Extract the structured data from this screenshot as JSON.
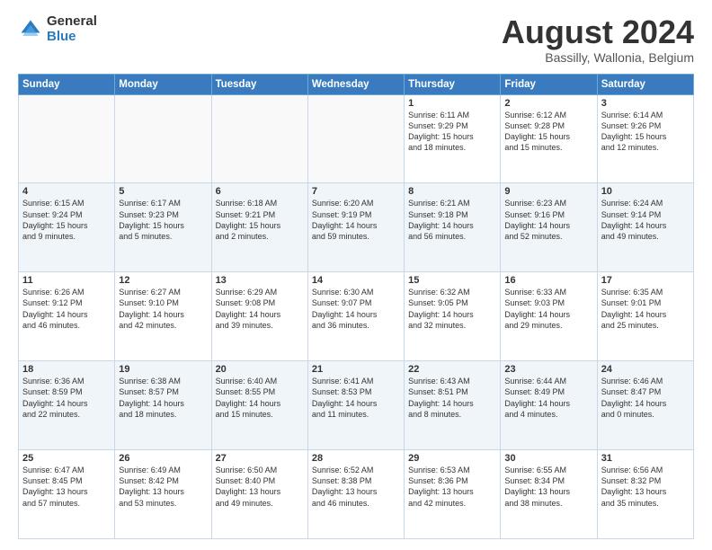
{
  "header": {
    "logo_general": "General",
    "logo_blue": "Blue",
    "month_title": "August 2024",
    "subtitle": "Bassilly, Wallonia, Belgium"
  },
  "calendar": {
    "days_of_week": [
      "Sunday",
      "Monday",
      "Tuesday",
      "Wednesday",
      "Thursday",
      "Friday",
      "Saturday"
    ],
    "weeks": [
      [
        {
          "day": "",
          "info": ""
        },
        {
          "day": "",
          "info": ""
        },
        {
          "day": "",
          "info": ""
        },
        {
          "day": "",
          "info": ""
        },
        {
          "day": "1",
          "info": "Sunrise: 6:11 AM\nSunset: 9:29 PM\nDaylight: 15 hours\nand 18 minutes."
        },
        {
          "day": "2",
          "info": "Sunrise: 6:12 AM\nSunset: 9:28 PM\nDaylight: 15 hours\nand 15 minutes."
        },
        {
          "day": "3",
          "info": "Sunrise: 6:14 AM\nSunset: 9:26 PM\nDaylight: 15 hours\nand 12 minutes."
        }
      ],
      [
        {
          "day": "4",
          "info": "Sunrise: 6:15 AM\nSunset: 9:24 PM\nDaylight: 15 hours\nand 9 minutes."
        },
        {
          "day": "5",
          "info": "Sunrise: 6:17 AM\nSunset: 9:23 PM\nDaylight: 15 hours\nand 5 minutes."
        },
        {
          "day": "6",
          "info": "Sunrise: 6:18 AM\nSunset: 9:21 PM\nDaylight: 15 hours\nand 2 minutes."
        },
        {
          "day": "7",
          "info": "Sunrise: 6:20 AM\nSunset: 9:19 PM\nDaylight: 14 hours\nand 59 minutes."
        },
        {
          "day": "8",
          "info": "Sunrise: 6:21 AM\nSunset: 9:18 PM\nDaylight: 14 hours\nand 56 minutes."
        },
        {
          "day": "9",
          "info": "Sunrise: 6:23 AM\nSunset: 9:16 PM\nDaylight: 14 hours\nand 52 minutes."
        },
        {
          "day": "10",
          "info": "Sunrise: 6:24 AM\nSunset: 9:14 PM\nDaylight: 14 hours\nand 49 minutes."
        }
      ],
      [
        {
          "day": "11",
          "info": "Sunrise: 6:26 AM\nSunset: 9:12 PM\nDaylight: 14 hours\nand 46 minutes."
        },
        {
          "day": "12",
          "info": "Sunrise: 6:27 AM\nSunset: 9:10 PM\nDaylight: 14 hours\nand 42 minutes."
        },
        {
          "day": "13",
          "info": "Sunrise: 6:29 AM\nSunset: 9:08 PM\nDaylight: 14 hours\nand 39 minutes."
        },
        {
          "day": "14",
          "info": "Sunrise: 6:30 AM\nSunset: 9:07 PM\nDaylight: 14 hours\nand 36 minutes."
        },
        {
          "day": "15",
          "info": "Sunrise: 6:32 AM\nSunset: 9:05 PM\nDaylight: 14 hours\nand 32 minutes."
        },
        {
          "day": "16",
          "info": "Sunrise: 6:33 AM\nSunset: 9:03 PM\nDaylight: 14 hours\nand 29 minutes."
        },
        {
          "day": "17",
          "info": "Sunrise: 6:35 AM\nSunset: 9:01 PM\nDaylight: 14 hours\nand 25 minutes."
        }
      ],
      [
        {
          "day": "18",
          "info": "Sunrise: 6:36 AM\nSunset: 8:59 PM\nDaylight: 14 hours\nand 22 minutes."
        },
        {
          "day": "19",
          "info": "Sunrise: 6:38 AM\nSunset: 8:57 PM\nDaylight: 14 hours\nand 18 minutes."
        },
        {
          "day": "20",
          "info": "Sunrise: 6:40 AM\nSunset: 8:55 PM\nDaylight: 14 hours\nand 15 minutes."
        },
        {
          "day": "21",
          "info": "Sunrise: 6:41 AM\nSunset: 8:53 PM\nDaylight: 14 hours\nand 11 minutes."
        },
        {
          "day": "22",
          "info": "Sunrise: 6:43 AM\nSunset: 8:51 PM\nDaylight: 14 hours\nand 8 minutes."
        },
        {
          "day": "23",
          "info": "Sunrise: 6:44 AM\nSunset: 8:49 PM\nDaylight: 14 hours\nand 4 minutes."
        },
        {
          "day": "24",
          "info": "Sunrise: 6:46 AM\nSunset: 8:47 PM\nDaylight: 14 hours\nand 0 minutes."
        }
      ],
      [
        {
          "day": "25",
          "info": "Sunrise: 6:47 AM\nSunset: 8:45 PM\nDaylight: 13 hours\nand 57 minutes."
        },
        {
          "day": "26",
          "info": "Sunrise: 6:49 AM\nSunset: 8:42 PM\nDaylight: 13 hours\nand 53 minutes."
        },
        {
          "day": "27",
          "info": "Sunrise: 6:50 AM\nSunset: 8:40 PM\nDaylight: 13 hours\nand 49 minutes."
        },
        {
          "day": "28",
          "info": "Sunrise: 6:52 AM\nSunset: 8:38 PM\nDaylight: 13 hours\nand 46 minutes."
        },
        {
          "day": "29",
          "info": "Sunrise: 6:53 AM\nSunset: 8:36 PM\nDaylight: 13 hours\nand 42 minutes."
        },
        {
          "day": "30",
          "info": "Sunrise: 6:55 AM\nSunset: 8:34 PM\nDaylight: 13 hours\nand 38 minutes."
        },
        {
          "day": "31",
          "info": "Sunrise: 6:56 AM\nSunset: 8:32 PM\nDaylight: 13 hours\nand 35 minutes."
        }
      ]
    ]
  }
}
